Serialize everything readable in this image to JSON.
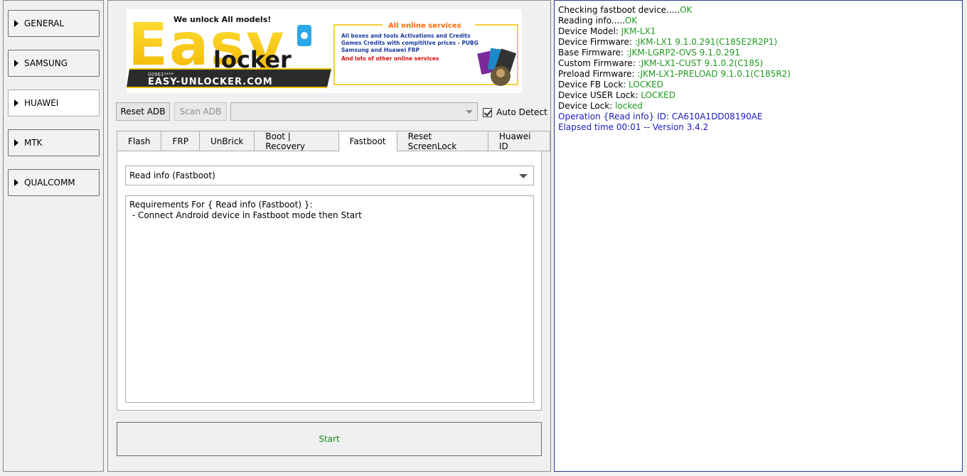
{
  "categories": [
    {
      "label": "GENERAL",
      "active": false
    },
    {
      "label": "SAMSUNG",
      "active": false
    },
    {
      "label": "HUAWEI",
      "active": true
    },
    {
      "label": "MTK",
      "active": false
    },
    {
      "label": "QUALCOMM",
      "active": false
    }
  ],
  "banner": {
    "headline": "We unlock All models!",
    "logo_top": "Easy",
    "logo_bottom": "locker",
    "phone": "00961****",
    "site": "EASY-UNLOCKER.COM",
    "services_title": "All online services",
    "services": [
      "All boxes and tools Activations and Credits",
      "Games Credits with compititive prices - PUBG",
      "Samsung and Huawei FRP",
      "And lots of other online services"
    ]
  },
  "toolbar": {
    "reset_adb": "Reset ADB",
    "scan_adb": "Scan ADB",
    "device_combo": "",
    "auto_detect": "Auto Detect"
  },
  "tabs": [
    "Flash",
    "FRP",
    "UnBrick",
    "Boot | Recovery",
    "Fastboot",
    "Reset ScreenLock",
    "Huawei ID"
  ],
  "active_tab": "Fastboot",
  "operation": {
    "selected": "Read info (Fastboot)",
    "requirements": "Requirements For { Read info (Fastboot) }:\n - Connect Android device in Fastboot mode then Start"
  },
  "start_label": "Start",
  "log": [
    {
      "label": "Checking fastboot device.....",
      "value": "OK",
      "kind": "ok"
    },
    {
      "label": "Reading info.....",
      "value": "OK",
      "kind": "ok"
    },
    {
      "label": "Device Model: ",
      "value": "JKM-LX1",
      "kind": "ok"
    },
    {
      "label": "Device Firmware: ",
      "value": ":JKM-LX1 9.1.0.291(C185E2R2P1)",
      "kind": "ok"
    },
    {
      "label": "Base Firmware: ",
      "value": ":JKM-LGRP2-OVS 9.1.0.291",
      "kind": "ok"
    },
    {
      "label": "Custom Firmware: ",
      "value": ":JKM-LX1-CUST 9.1.0.2(C185)",
      "kind": "ok"
    },
    {
      "label": "Preload Firmware: ",
      "value": ":JKM-LX1-PRELOAD 9.1.0.1(C185R2)",
      "kind": "ok"
    },
    {
      "label": "Device FB Lock: ",
      "value": "LOCKED",
      "kind": "ok"
    },
    {
      "label": "Device USER Lock: ",
      "value": "LOCKED",
      "kind": "ok"
    },
    {
      "label": "Device Lock: ",
      "value": "locked",
      "kind": "ok"
    },
    {
      "label": "Operation {Read info} ID: CA610A1DD08190AE",
      "value": "",
      "kind": "blue"
    },
    {
      "label": "Elapsed time 00:01 -- Version 3.4.2",
      "value": "",
      "kind": "blue"
    }
  ]
}
